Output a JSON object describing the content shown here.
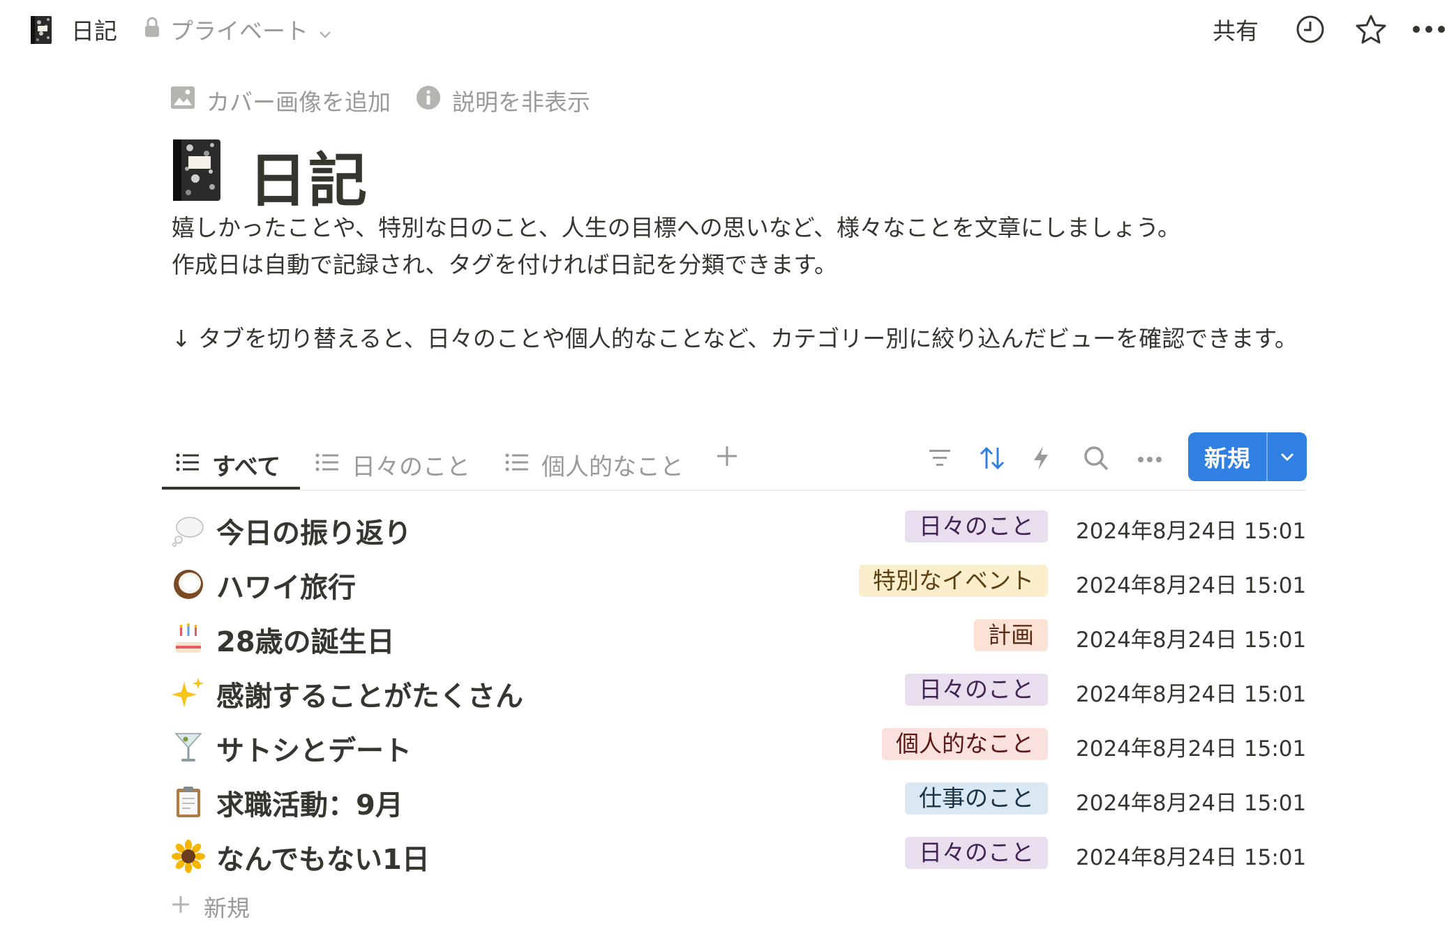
{
  "topbar": {
    "breadcrumb_title": "日記",
    "privacy": "プライベート",
    "share": "共有",
    "icons": [
      "composition-notebook-icon",
      "lock-icon",
      "chevron-down-icon",
      "clock-icon",
      "star-icon",
      "more-icon"
    ]
  },
  "page_actions": {
    "add_cover": "カバー画像を追加",
    "hide_description": "説明を非表示"
  },
  "page": {
    "title": "日記",
    "description_line1": "嬉しかったことや、特別な日のこと、人生の目標への思いなど、様々なことを文章にしましょう。",
    "description_line2": "作成日は自動で記録され、タグを付ければ日記を分類できます。",
    "description_line3": "↓ タブを切り替えると、日々のことや個人的なことなど、カテゴリー別に絞り込んだビューを確認できます。"
  },
  "tabs": [
    {
      "label": "すべて",
      "active": true
    },
    {
      "label": "日々のこと",
      "active": false
    },
    {
      "label": "個人的なこと",
      "active": false
    }
  ],
  "toolbar": {
    "new_label": "新規",
    "icons": [
      "filter-icon",
      "sort-icon",
      "automation-icon",
      "search-icon",
      "more-icon",
      "chevron-down-icon"
    ]
  },
  "entries": [
    {
      "emoji": "thought-balloon",
      "title": "今日の振り返り",
      "tag": "日々のこと",
      "tag_color": "#e8deee",
      "tag_text": "#412454",
      "date": "2024年8月24日 15:01"
    },
    {
      "emoji": "coconut",
      "title": "ハワイ旅行",
      "tag": "特別なイベント",
      "tag_color": "#fbeecc",
      "tag_text": "#5c4213",
      "date": "2024年8月24日 15:01"
    },
    {
      "emoji": "birthday-cake",
      "title": "28歳の誕生日",
      "tag": "計画",
      "tag_color": "#fce2d4",
      "tag_text": "#5c2d16",
      "date": "2024年8月24日 15:01"
    },
    {
      "emoji": "sparkles",
      "title": "感謝することがたくさん",
      "tag": "日々のこと",
      "tag_color": "#e8deee",
      "tag_text": "#412454",
      "date": "2024年8月24日 15:01"
    },
    {
      "emoji": "cocktail-glass",
      "title": "サトシとデート",
      "tag": "個人的なこと",
      "tag_color": "#fbe1de",
      "tag_text": "#5d1715",
      "date": "2024年8月24日 15:01"
    },
    {
      "emoji": "clipboard",
      "title": "求職活動：9月",
      "tag": "仕事のこと",
      "tag_color": "#d9e8f2",
      "tag_text": "#183347",
      "date": "2024年8月24日 15:01"
    },
    {
      "emoji": "sunflower",
      "title": "なんでもない1日",
      "tag": "日々のこと",
      "tag_color": "#e8deee",
      "tag_text": "#412454",
      "date": "2024年8月24日 15:01"
    }
  ],
  "add_new": "新規",
  "colors": {
    "accent": "#2f80e2",
    "text": "#37352f",
    "muted": "#9b9a97"
  }
}
